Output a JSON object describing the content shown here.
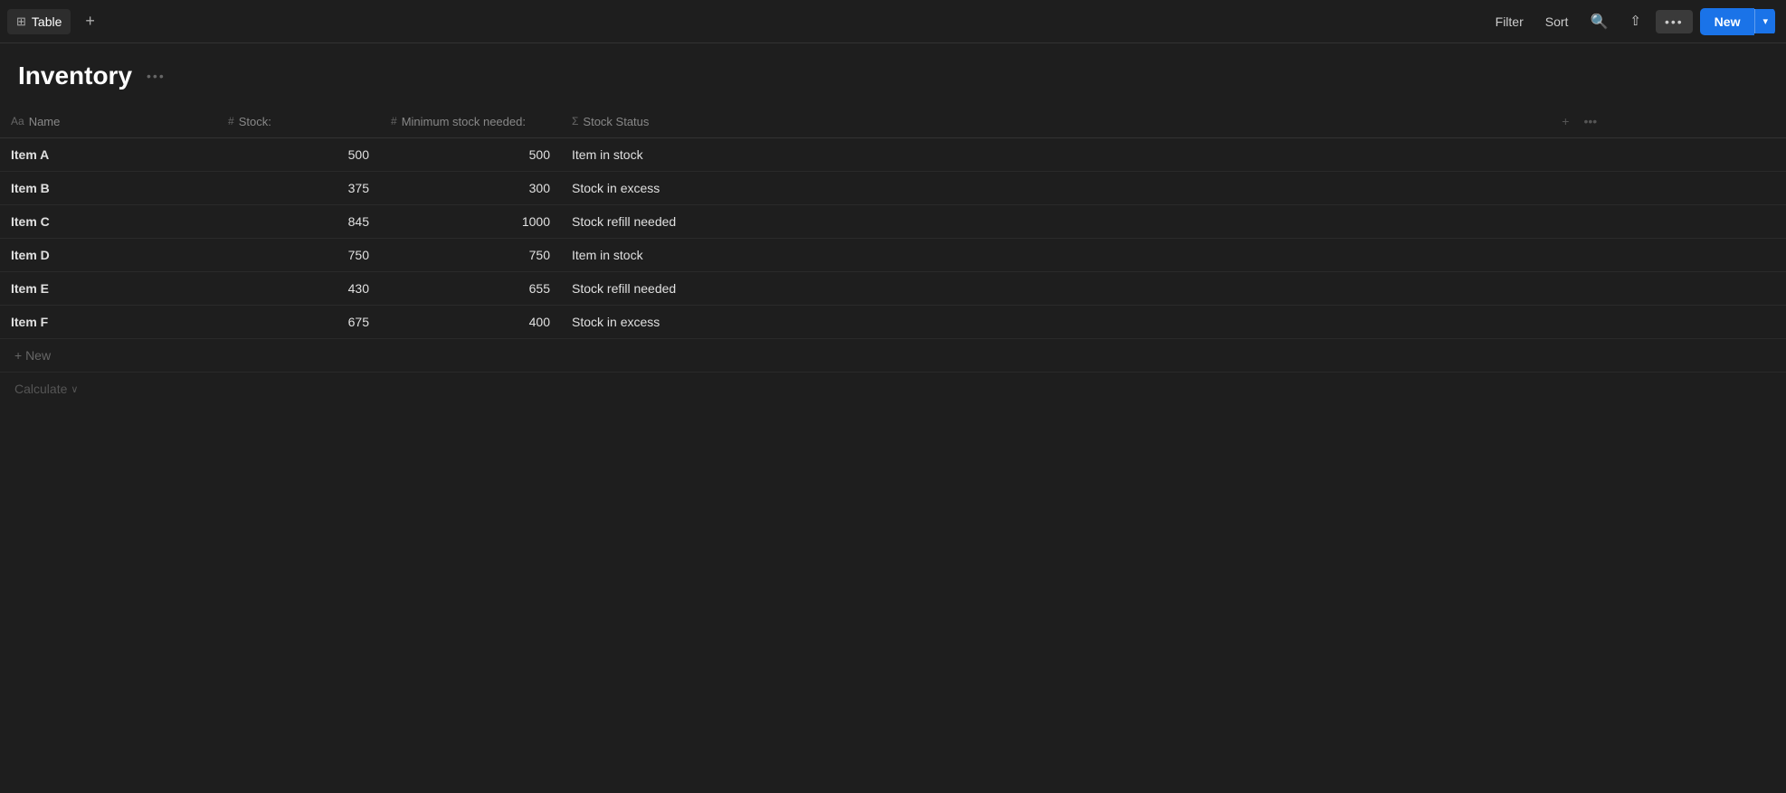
{
  "topbar": {
    "tab_label": "Table",
    "tab_icon": "⊞",
    "add_tab_label": "+",
    "filter_label": "Filter",
    "sort_label": "Sort",
    "search_icon": "🔍",
    "share_icon": "⇪",
    "more_label": "•••",
    "new_label": "New",
    "new_dropdown_icon": "▾"
  },
  "page": {
    "title": "Inventory",
    "title_more": "•••"
  },
  "columns": [
    {
      "id": "name",
      "type": "Aa",
      "label": "Name"
    },
    {
      "id": "stock",
      "type": "#",
      "label": "Stock:"
    },
    {
      "id": "min_stock",
      "type": "#",
      "label": "Minimum stock needed:"
    },
    {
      "id": "status",
      "type": "Σ",
      "label": "Stock Status"
    }
  ],
  "column_actions": {
    "add_icon": "+",
    "more_icon": "•••"
  },
  "rows": [
    {
      "name": "Item A",
      "stock": "500",
      "min_stock": "500",
      "status": "Item in stock"
    },
    {
      "name": "Item B",
      "stock": "375",
      "min_stock": "300",
      "status": "Stock in excess"
    },
    {
      "name": "Item C",
      "stock": "845",
      "min_stock": "1000",
      "status": "Stock refill needed"
    },
    {
      "name": "Item D",
      "stock": "750",
      "min_stock": "750",
      "status": "Item in stock"
    },
    {
      "name": "Item E",
      "stock": "430",
      "min_stock": "655",
      "status": "Stock refill needed"
    },
    {
      "name": "Item F",
      "stock": "675",
      "min_stock": "400",
      "status": "Stock in excess"
    }
  ],
  "add_row_label": "+ New",
  "calculate_label": "Calculate",
  "calculate_chevron": "∨"
}
